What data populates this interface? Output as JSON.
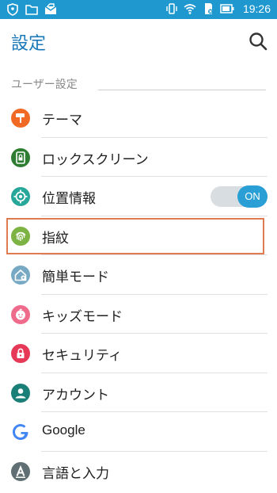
{
  "status_bar": {
    "time": "19:26",
    "icons": [
      "shield-icon",
      "folder-icon",
      "mail-icon",
      "vibrate-icon",
      "wifi-icon",
      "sd-card-icon",
      "battery-icon"
    ]
  },
  "header": {
    "title": "設定"
  },
  "section": {
    "label": "ユーザー設定"
  },
  "items": [
    {
      "label": "テーマ",
      "icon": "theme-icon",
      "icon_color": "#f06a25"
    },
    {
      "label": "ロックスクリーン",
      "icon": "lockscreen-icon",
      "icon_color": "#2f7d32"
    },
    {
      "label": "位置情報",
      "icon": "location-icon",
      "icon_color": "#27a69a",
      "toggle": "ON"
    },
    {
      "label": "指紋",
      "icon": "fingerprint-icon",
      "icon_color": "#7cb342",
      "highlighted": true
    },
    {
      "label": "簡単モード",
      "icon": "easy-mode-icon",
      "icon_color": "#78a9c4"
    },
    {
      "label": "キッズモード",
      "icon": "kids-mode-icon",
      "icon_color": "#ef6b8c"
    },
    {
      "label": "セキュリティ",
      "icon": "security-icon",
      "icon_color": "#e53957"
    },
    {
      "label": "アカウント",
      "icon": "account-icon",
      "icon_color": "#1a7f76"
    },
    {
      "label": "Google",
      "icon": "google-icon",
      "icon_color": "#4285f4"
    },
    {
      "label": "言語と入力",
      "icon": "language-icon",
      "icon_color": "#5f6f73"
    }
  ],
  "colors": {
    "accent": "#1f98cf",
    "title": "#1a78b8",
    "highlight_border": "#e07a50",
    "toggle_on": "#2a9fd6"
  }
}
